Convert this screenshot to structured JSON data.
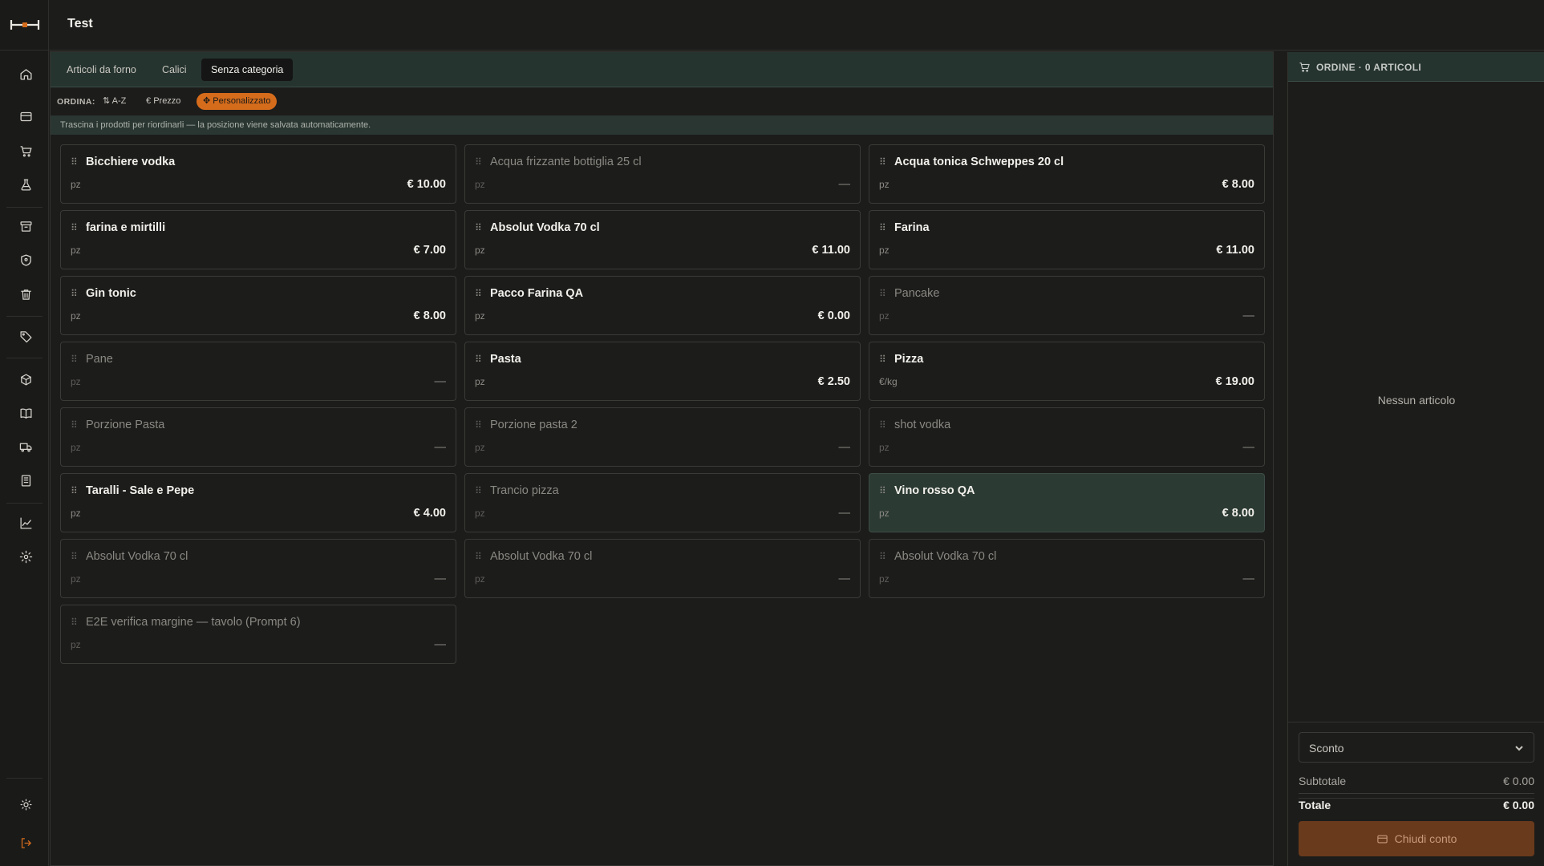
{
  "header": {
    "title": "Test"
  },
  "sidebar": {
    "icons": [
      "home-icon",
      "card-icon",
      "cart-icon",
      "flask-icon",
      "archive-icon",
      "shield-icon",
      "trash-icon",
      "tag-icon",
      "box-icon",
      "book-icon",
      "truck-icon",
      "building-icon",
      "chart-icon",
      "gear-icon",
      "sun-icon",
      "logout-icon"
    ]
  },
  "tabs": [
    {
      "label": "Articoli da forno",
      "active": false
    },
    {
      "label": "Calici",
      "active": false
    },
    {
      "label": "Senza categoria",
      "active": true
    }
  ],
  "sort": {
    "label": "ORDINA:",
    "options": [
      {
        "label": "A-Z",
        "active": false
      },
      {
        "label": "Prezzo",
        "active": false
      },
      {
        "label": "Personalizzato",
        "active": true
      }
    ]
  },
  "hint": "Trascina i prodotti per riordinarli — la posizione viene salvata automaticamente.",
  "products": [
    {
      "name": "Bicchiere vodka",
      "unit": "pz",
      "price": "€ 10.00",
      "disabled": false
    },
    {
      "name": "Acqua frizzante bottiglia 25 cl",
      "unit": "pz",
      "price": "—",
      "disabled": true
    },
    {
      "name": "Acqua tonica Schweppes 20 cl",
      "unit": "pz",
      "price": "€ 8.00",
      "disabled": false
    },
    {
      "name": "farina e mirtilli",
      "unit": "pz",
      "price": "€ 7.00",
      "disabled": false
    },
    {
      "name": "Absolut Vodka 70 cl",
      "unit": "pz",
      "price": "€ 11.00",
      "disabled": false
    },
    {
      "name": "Farina",
      "unit": "pz",
      "price": "€ 11.00",
      "disabled": false
    },
    {
      "name": "Gin tonic",
      "unit": "pz",
      "price": "€ 8.00",
      "disabled": false
    },
    {
      "name": "Pacco Farina QA",
      "unit": "pz",
      "price": "€ 0.00",
      "disabled": false
    },
    {
      "name": "Pancake",
      "unit": "pz",
      "price": "—",
      "disabled": true
    },
    {
      "name": "Pane",
      "unit": "pz",
      "price": "—",
      "disabled": true
    },
    {
      "name": "Pasta",
      "unit": "pz",
      "price": "€ 2.50",
      "disabled": false
    },
    {
      "name": "Pizza",
      "unit": "€/kg",
      "price": "€ 19.00",
      "disabled": false
    },
    {
      "name": "Porzione Pasta",
      "unit": "pz",
      "price": "—",
      "disabled": true
    },
    {
      "name": "Porzione pasta 2",
      "unit": "pz",
      "price": "—",
      "disabled": true
    },
    {
      "name": "shot vodka",
      "unit": "pz",
      "price": "—",
      "disabled": true
    },
    {
      "name": "Taralli - Sale e Pepe",
      "unit": "pz",
      "price": "€ 4.00",
      "disabled": false
    },
    {
      "name": "Trancio pizza",
      "unit": "pz",
      "price": "—",
      "disabled": true
    },
    {
      "name": "Vino rosso QA",
      "unit": "pz",
      "price": "€ 8.00",
      "disabled": false,
      "highlight": true
    },
    {
      "name": "Absolut Vodka 70 cl",
      "unit": "pz",
      "price": "—",
      "disabled": true
    },
    {
      "name": "Absolut Vodka 70 cl",
      "unit": "pz",
      "price": "—",
      "disabled": true
    },
    {
      "name": "Absolut Vodka 70 cl",
      "unit": "pz",
      "price": "—",
      "disabled": true
    },
    {
      "name": "E2E verifica margine — tavolo (Prompt 6)",
      "unit": "pz",
      "price": "—",
      "disabled": true
    }
  ],
  "order": {
    "title": "ORDINE · 0 ARTICOLI",
    "empty": "Nessun articolo",
    "discount_placeholder": "Sconto",
    "subtotal_label": "Subtotale",
    "subtotal_value": "€ 0.00",
    "total_label": "Totale",
    "total_value": "€ 0.00",
    "close_label": "Chiudi conto"
  },
  "colors": {
    "accent": "#d56c1c",
    "panel_green": "#263430",
    "close_button": "#6a3a1c"
  }
}
